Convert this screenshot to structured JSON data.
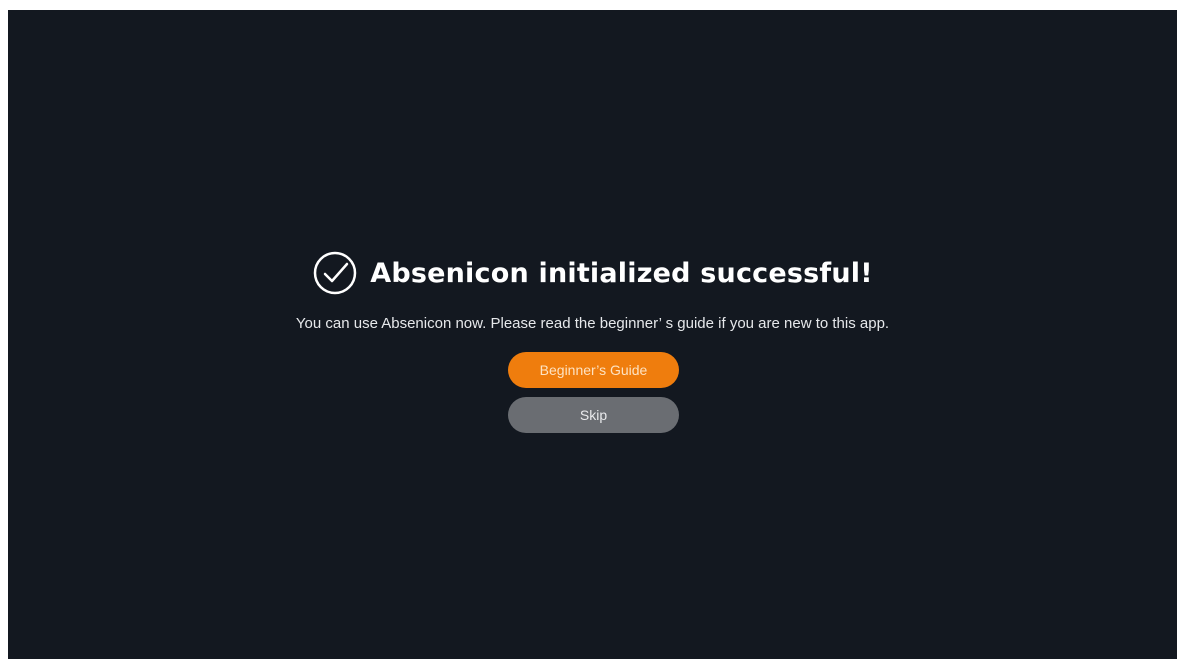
{
  "dialog": {
    "icon": "check-circle-icon",
    "title": "Absenicon initialized successful!",
    "message": "You can use Absenicon now. Please read the beginner’ s guide if you are new to this app.",
    "buttons": {
      "guide_label": "Beginner’s Guide",
      "skip_label": "Skip"
    }
  },
  "colors": {
    "background": "#131820",
    "primary_button": "#ef7d0d",
    "secondary_button": "#6a6d72",
    "text": "#ffffff"
  }
}
